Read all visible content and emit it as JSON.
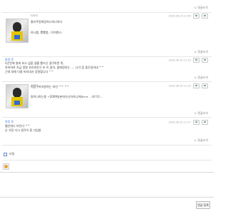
{
  "top_reply_link": "↳ 댓글쓰기",
  "comments": [
    {
      "author": "nana",
      "date": "2010.06.10 11:09",
      "lines": [
        "몰라주땅희망하나하나하다",
        "",
        "하나봄, 뿅뿅봄...이히랜스.."
      ],
      "reply": "↳ 댓글쓰기"
    },
    {
      "author": "파랑 토",
      "date": "2010.06.10 11:13",
      "lines": [
        "2년전에 벌써 보고 싶을 생활 했으신 생각하면 뭐,",
        "하하하하 지금 정말 유리와친구 또 이 좋아, 몰래원하는 .... 나가 참 좋은일하네 ^^",
        "근데 대체 다름 비지내서 응원합니다 ^^"
      ],
      "reply": "↳ 댓글쓰기"
    },
    {
      "author": "nana",
      "date": "2010.06.10 11:15",
      "lines": [
        "지금구하자원하는 보인 ^^ ^^",
        "",
        "원이나하는중 ~2009일본마다닌아하니까요ㅠㅠ ...하!!😊..."
      ],
      "reply": "↳ 댓글쓰기"
    },
    {
      "author": "파랑 토",
      "date": "2010.06.10 11:17",
      "lines": [
        "뭘인데나 보인다 ^^",
        "난 가장 다시 생각이 좋 다입봅"
      ],
      "reply": "↳ 댓글쓰기"
    }
  ],
  "form": {
    "secret_label": "비밀",
    "submit_label": "댓글 등록"
  }
}
